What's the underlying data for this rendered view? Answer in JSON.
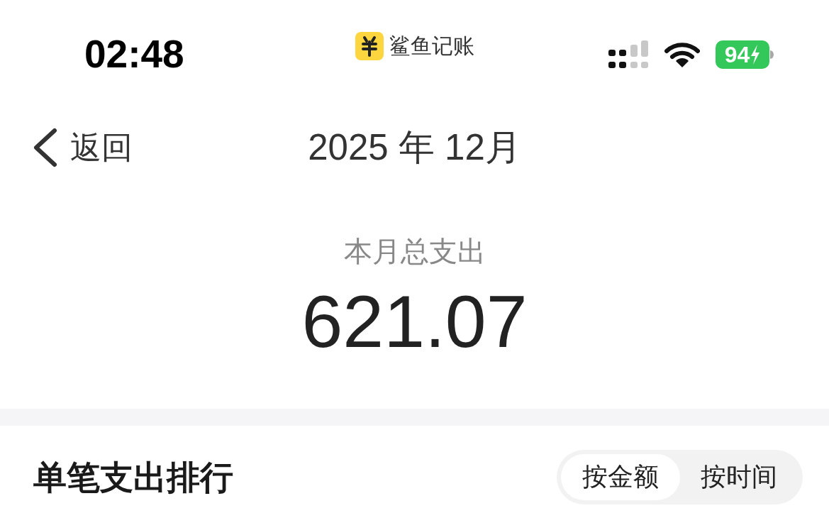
{
  "status_bar": {
    "time": "02:48",
    "app_name": "鲨鱼记账",
    "battery": {
      "percent": "94",
      "charging": true
    }
  },
  "nav": {
    "back_label": "返回",
    "title": "2025 年 12月"
  },
  "summary": {
    "label": "本月总支出",
    "amount": "621.07"
  },
  "ranking": {
    "title": "单笔支出排行",
    "sort_options": [
      {
        "label": "按金额",
        "selected": true
      },
      {
        "label": "按时间",
        "selected": false
      }
    ]
  }
}
